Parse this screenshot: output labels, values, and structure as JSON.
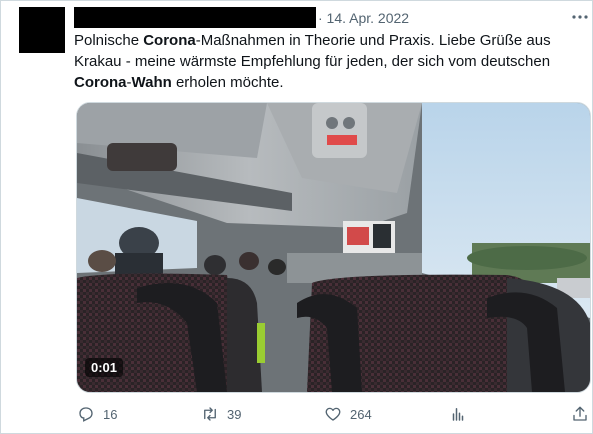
{
  "tweet": {
    "date": "· 14. Apr. 2022",
    "text_parts": [
      {
        "t": "Polnische ",
        "bold": false
      },
      {
        "t": "Corona",
        "bold": true
      },
      {
        "t": "-Maßnahmen in Theorie und Praxis. Liebe Grüße aus Krakau - meine wärmste Empfehlung für jeden, der sich vom deutschen ",
        "bold": false
      },
      {
        "t": "Corona",
        "bold": true
      },
      {
        "t": "-",
        "bold": false
      },
      {
        "t": "Wahn",
        "bold": true
      },
      {
        "t": " erholen möchte.",
        "bold": false
      }
    ],
    "video_time": "0:01"
  },
  "actions": {
    "replies": "16",
    "retweets": "39",
    "likes": "264"
  },
  "icons": {
    "more": "more-icon",
    "reply": "reply-icon",
    "retweet": "retweet-icon",
    "like": "heart-icon",
    "analytics": "analytics-icon",
    "share": "share-icon"
  },
  "colors": {
    "secondary_text": "#536471",
    "border": "#cfd9de"
  }
}
